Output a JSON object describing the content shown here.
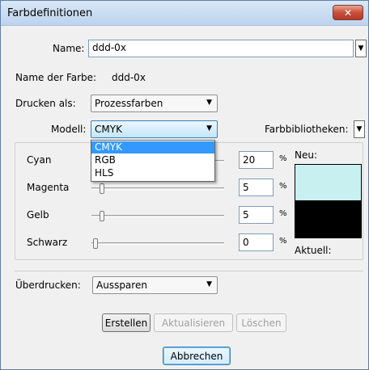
{
  "window": {
    "title": "Farbdefinitionen",
    "close_icon": "close-icon"
  },
  "name": {
    "label": "Name:",
    "value": "ddd-0x"
  },
  "color_name": {
    "label": "Name der Farbe:",
    "value": "ddd-0x"
  },
  "print_as": {
    "label": "Drucken als:",
    "value": "Prozessfarben"
  },
  "model": {
    "label": "Modell:",
    "value": "CMYK",
    "options": [
      "CMYK",
      "RGB",
      "HLS"
    ]
  },
  "libraries": {
    "label": "Farbbibliotheken:"
  },
  "sliders": [
    {
      "label": "Cyan",
      "value": "20",
      "fraction": 0.2
    },
    {
      "label": "Magenta",
      "value": "5",
      "fraction": 0.05
    },
    {
      "label": "Gelb",
      "value": "5",
      "fraction": 0.05
    },
    {
      "label": "Schwarz",
      "value": "0",
      "fraction": 0.0
    }
  ],
  "percent_sign": "%",
  "preview": {
    "new_label": "Neu:",
    "current_label": "Aktuell:",
    "new_color": "#c9f0f0",
    "current_color": "#000000"
  },
  "overprint": {
    "label": "Überdrucken:",
    "value": "Aussparen"
  },
  "buttons": {
    "create": "Erstellen",
    "update": "Aktualisieren",
    "delete": "Löschen",
    "cancel": "Abbrechen"
  }
}
